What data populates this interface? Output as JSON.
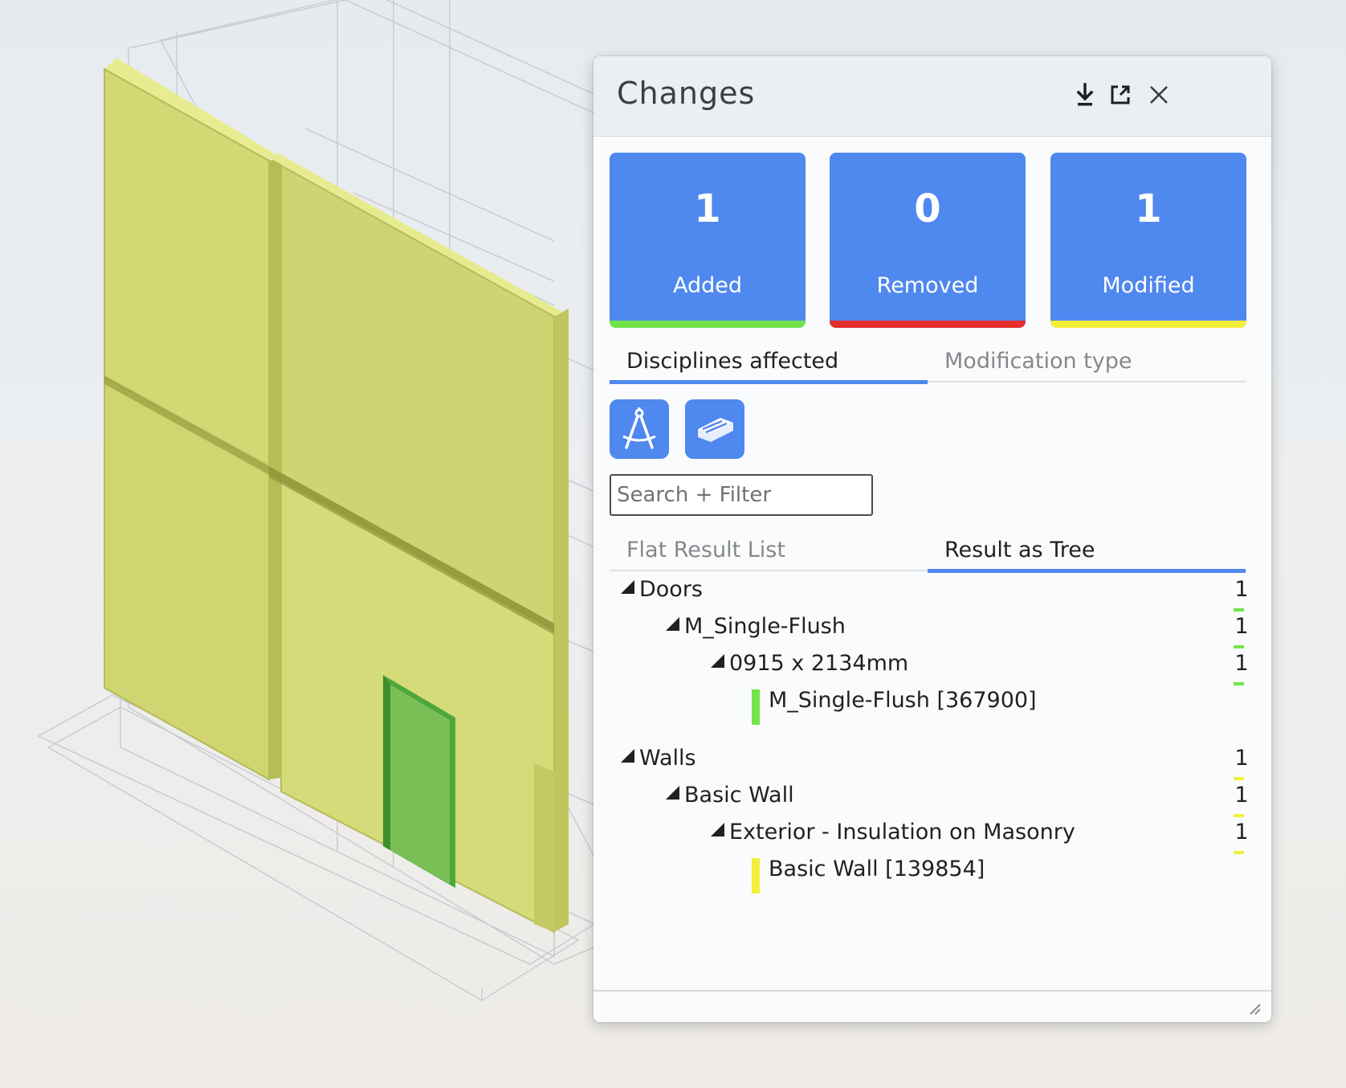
{
  "panel": {
    "title": "Changes",
    "header_icons": [
      "download-icon",
      "popout-icon",
      "close-icon"
    ]
  },
  "stats": [
    {
      "count": "1",
      "label": "Added",
      "bar_color": "#73e34a"
    },
    {
      "count": "0",
      "label": "Removed",
      "bar_color": "#e42d2d"
    },
    {
      "count": "1",
      "label": "Modified",
      "bar_color": "#f2ef3c"
    }
  ],
  "view_tabs": [
    {
      "label": "Disciplines affected",
      "active": true
    },
    {
      "label": "Modification type",
      "active": false
    }
  ],
  "disciplines": [
    "architecture-compass-icon",
    "structural-beam-icon"
  ],
  "search": {
    "placeholder": "Search + Filter",
    "value": ""
  },
  "result_tabs": [
    {
      "label": "Flat Result List",
      "active": false
    },
    {
      "label": "Result as Tree",
      "active": true
    }
  ],
  "tree": [
    {
      "label": "Doors",
      "count": "1",
      "color": "#73e34a",
      "children": [
        {
          "label": "M_Single-Flush",
          "count": "1",
          "children": [
            {
              "label": "0915 x 2134mm",
              "count": "1",
              "children": [
                {
                  "label": "M_Single-Flush [367900]"
                }
              ]
            }
          ]
        }
      ]
    },
    {
      "label": "Walls",
      "count": "1",
      "color": "#f2ef3c",
      "children": [
        {
          "label": "Basic Wall",
          "count": "1",
          "children": [
            {
              "label": "Exterior - Insulation on Masonry",
              "count": "1",
              "children": [
                {
                  "label": "Basic Wall [139854]"
                }
              ]
            }
          ]
        }
      ]
    }
  ],
  "colors": {
    "accent": "#4f88ee",
    "added": "#73e34a",
    "removed": "#e42d2d",
    "modified": "#f2ef3c",
    "wall": "#d2d772",
    "door": "#74bf57"
  }
}
